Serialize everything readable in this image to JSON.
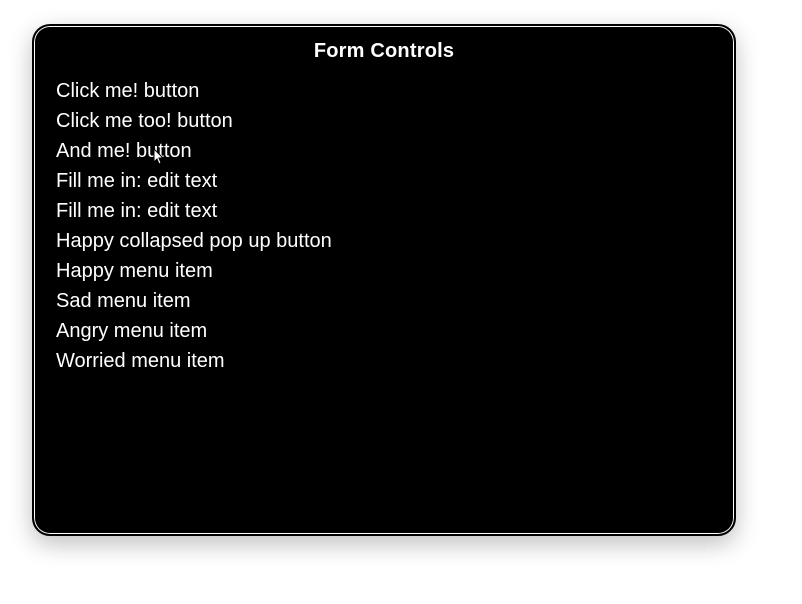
{
  "title": "Form Controls",
  "items": [
    {
      "label": "Click me! button",
      "name": "button-click-me",
      "interactable": true
    },
    {
      "label": "Click me too! button",
      "name": "button-click-me-too",
      "interactable": true
    },
    {
      "label": "And me! button",
      "name": "button-and-me",
      "interactable": true
    },
    {
      "label": "Fill me in: edit text",
      "name": "edit-text-1",
      "interactable": true
    },
    {
      "label": "Fill me in: edit text",
      "name": "edit-text-2",
      "interactable": true
    },
    {
      "label": "Happy collapsed pop up button",
      "name": "popup-button-happy",
      "interactable": true
    },
    {
      "label": "Happy menu item",
      "name": "menu-item-happy",
      "interactable": true
    },
    {
      "label": "Sad menu item",
      "name": "menu-item-sad",
      "interactable": true
    },
    {
      "label": "Angry menu item",
      "name": "menu-item-angry",
      "interactable": true
    },
    {
      "label": "Worried menu item",
      "name": "menu-item-worried",
      "interactable": true
    }
  ]
}
